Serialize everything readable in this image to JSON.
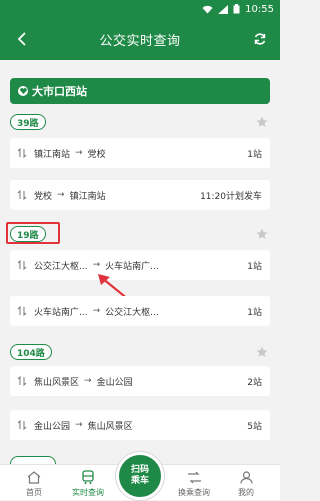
{
  "status_bar": {
    "time": "10:55"
  },
  "header": {
    "title": "公交实时查询"
  },
  "station": {
    "name": "大市口西站"
  },
  "routes": [
    {
      "name": "39路",
      "trips": [
        {
          "from": "镇江南站",
          "arrow": "→",
          "to": "党校",
          "info": "1站"
        },
        {
          "from": "党校",
          "arrow": "→",
          "to": "镇江南站",
          "info": "11:20计划发车"
        }
      ]
    },
    {
      "name": "19路",
      "trips": [
        {
          "from": "公交江大枢...",
          "arrow": "→",
          "to": "火车站南广...",
          "info": "1站"
        },
        {
          "from": "火车站南广...",
          "arrow": "→",
          "to": "公交江大枢...",
          "info": "1站"
        }
      ]
    },
    {
      "name": "104路",
      "trips": [
        {
          "from": "焦山风景区",
          "arrow": "→",
          "to": "金山公园",
          "info": "2站"
        },
        {
          "from": "金山公园",
          "arrow": "→",
          "to": "焦山风景区",
          "info": "5站"
        }
      ]
    }
  ],
  "tabs": [
    {
      "label": "首页",
      "icon": "home-icon"
    },
    {
      "label": "实时查询",
      "icon": "bus-icon"
    },
    {
      "label": "换乘查询",
      "icon": "transfer-icon"
    },
    {
      "label": "我的",
      "icon": "person-icon"
    }
  ],
  "scan_button": {
    "line1": "扫码",
    "line2": "乘车"
  },
  "colors": {
    "brand": "#1f8a47",
    "highlight": "#e0323a"
  }
}
